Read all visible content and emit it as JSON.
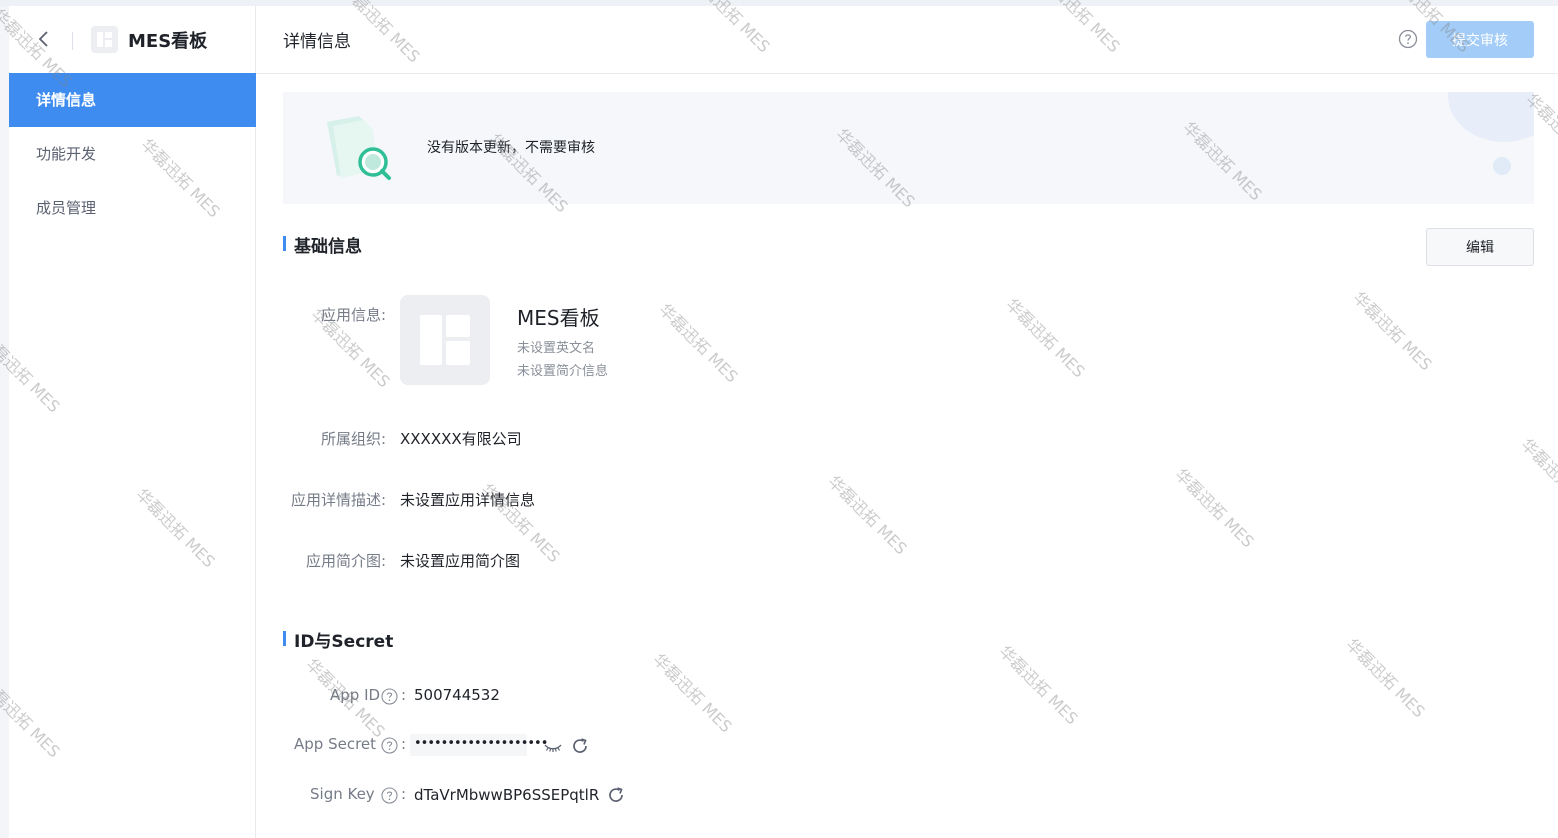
{
  "app": {
    "name": "MES看板"
  },
  "sidebar": {
    "items": [
      {
        "label": "详情信息",
        "active": true
      },
      {
        "label": "功能开发",
        "active": false
      },
      {
        "label": "成员管理",
        "active": false
      }
    ]
  },
  "header": {
    "title": "详情信息",
    "submit_label": "提交审核"
  },
  "banner": {
    "text": "没有版本更新，不需要审核"
  },
  "basic": {
    "title": "基础信息",
    "edit_label": "编辑",
    "app_info_label": "应用信息:",
    "app_name": "MES看板",
    "english_name": "未设置英文名",
    "intro": "未设置简介信息",
    "org_label": "所属组织:",
    "org_value": "XXXXXX有限公司",
    "desc_label": "应用详情描述:",
    "desc_value": "未设置应用详情信息",
    "image_label": "应用简介图:",
    "image_value": "未设置应用简介图"
  },
  "ids": {
    "title": "ID与Secret",
    "app_id_label": "App ID",
    "app_id_value": "500744532",
    "app_secret_label": "App Secret",
    "app_secret_masked": "••••••••••••••••••••",
    "sign_key_label": "Sign Key",
    "sign_key_value": "dTaVrMbwwBP6SSEPqtlR",
    "colon": ":"
  },
  "watermark": {
    "text": "华磊迅拓 MES"
  },
  "colors": {
    "accent": "#3f8cf0",
    "submit_disabled": "#a3cdf8",
    "label": "#757b87"
  },
  "icons": [
    "back-arrow-icon",
    "app-grid-icon",
    "help-circle-icon",
    "search-doc-illustration",
    "question-icon",
    "eye-closed-icon",
    "refresh-icon"
  ]
}
